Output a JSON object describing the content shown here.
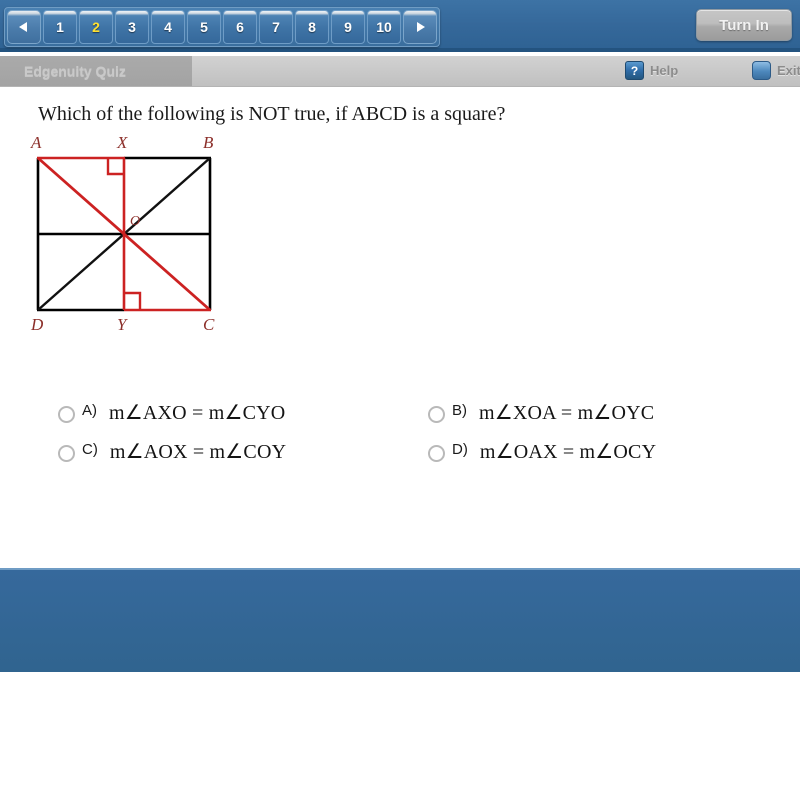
{
  "topbar": {
    "prev_arrow": "prev-page",
    "next_arrow": "next-page",
    "pages": [
      "1",
      "2",
      "3",
      "4",
      "5",
      "6",
      "7",
      "8",
      "9",
      "10"
    ],
    "current_page": "2",
    "turn_in_label": "Turn In",
    "background_color": "#35689a"
  },
  "toolbar": {
    "quiz_tab_label": "Edgenuity Quiz",
    "help_icon_glyph": "?",
    "help_label": "Help",
    "exit_label": "Exit",
    "background_color": "#c9c9c9"
  },
  "question": {
    "text": "Which of the following is NOT true, if ABCD is a square?"
  },
  "diagram": {
    "title": "square-abcd-diagonals",
    "vertex_labels": {
      "A": "A",
      "B": "B",
      "C": "C",
      "D": "D",
      "X": "X",
      "Y": "Y",
      "O": "O"
    },
    "label_color": "#8c2f2a",
    "red_stroke": "#cc2222",
    "black_stroke": "#000000"
  },
  "answers": [
    {
      "letter": "A)",
      "text": "m∠AXO = m∠CYO",
      "selected": false
    },
    {
      "letter": "B)",
      "text": "m∠XOA = m∠OYC",
      "selected": false
    },
    {
      "letter": "C)",
      "text": "m∠AOX = m∠COY",
      "selected": false
    },
    {
      "letter": "D)",
      "text": "m∠OAX = m∠OCY",
      "selected": false
    }
  ],
  "bottom_panel": {
    "color": "#33669a"
  }
}
